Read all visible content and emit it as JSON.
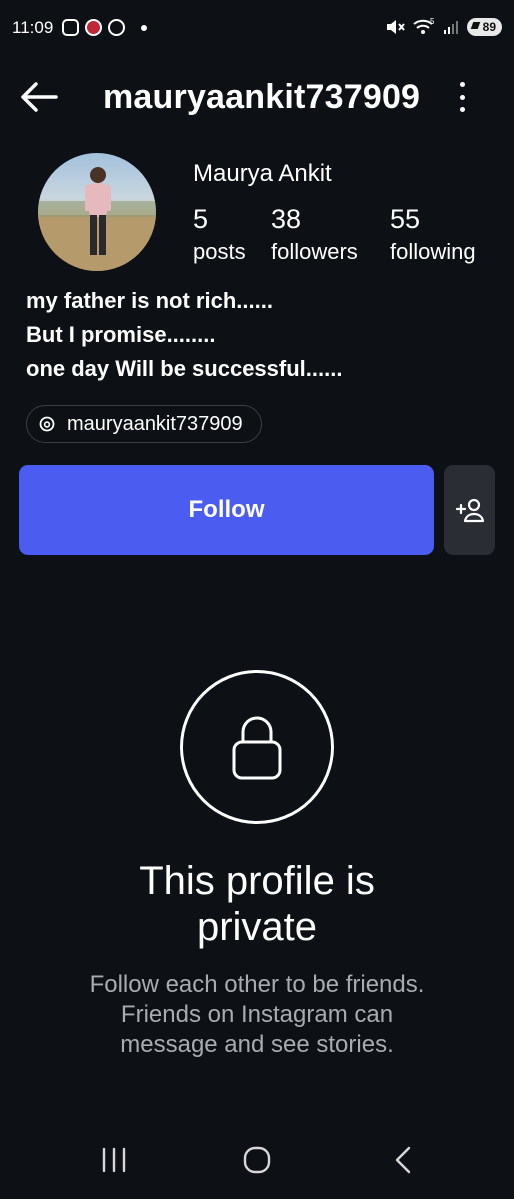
{
  "status_bar": {
    "time": "11:09",
    "left_icons": [
      "instagram-icon",
      "app-icon",
      "alarm-icon"
    ],
    "right_icons": [
      "mute-icon",
      "wifi-icon",
      "signal-icon"
    ],
    "wifi_badge": "5",
    "battery": "89"
  },
  "header": {
    "username": "mauryaankit737909",
    "back_icon": "arrow-left-icon",
    "more_icon": "more-vertical-icon"
  },
  "profile": {
    "display_name": "Maurya Ankit",
    "stats": [
      {
        "value": "5",
        "label": "posts"
      },
      {
        "value": "38",
        "label": "followers"
      },
      {
        "value": "55",
        "label": "following"
      }
    ],
    "bio": [
      "my father is not rich......",
      "But I promise........",
      "one day Will be successful......"
    ],
    "threads_handle": "mauryaankit737909"
  },
  "actions": {
    "follow_label": "Follow",
    "suggest_icon": "add-person-icon"
  },
  "private": {
    "title_line1": "This profile is",
    "title_line2": "private",
    "subtitle": "Follow each other to be friends. Friends on Instagram can message and see stories."
  },
  "colors": {
    "background": "#0d1014",
    "follow_button": "#4a5df0",
    "secondary_button": "#2a2d33",
    "muted_text": "#a8abb0"
  }
}
